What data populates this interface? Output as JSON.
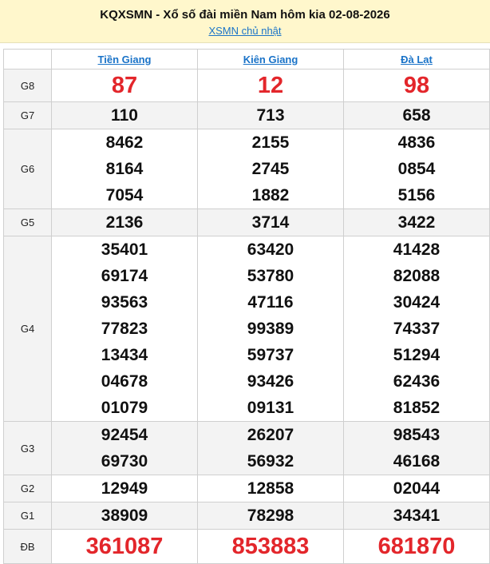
{
  "header": {
    "title": "KQXSMN - Xổ số đài miền Nam hôm kia 02-08-2026",
    "link": "XSMN chủ nhật"
  },
  "colors": {
    "accent_red": "#e3262b",
    "link_blue": "#1a73c8",
    "header_bg": "#fff7cc"
  },
  "provinces": [
    "Tiền Giang",
    "Kiên Giang",
    "Đà Lạt"
  ],
  "prizes": [
    {
      "label": "G8",
      "style": "big",
      "alt": false,
      "values": [
        [
          "87"
        ],
        [
          "12"
        ],
        [
          "98"
        ]
      ]
    },
    {
      "label": "G7",
      "style": "normal",
      "alt": true,
      "values": [
        [
          "110"
        ],
        [
          "713"
        ],
        [
          "658"
        ]
      ]
    },
    {
      "label": "G6",
      "style": "normal",
      "alt": false,
      "values": [
        [
          "8462",
          "8164",
          "7054"
        ],
        [
          "2155",
          "2745",
          "1882"
        ],
        [
          "4836",
          "0854",
          "5156"
        ]
      ]
    },
    {
      "label": "G5",
      "style": "normal",
      "alt": true,
      "values": [
        [
          "2136"
        ],
        [
          "3714"
        ],
        [
          "3422"
        ]
      ]
    },
    {
      "label": "G4",
      "style": "normal",
      "alt": false,
      "values": [
        [
          "35401",
          "69174",
          "93563",
          "77823",
          "13434",
          "04678",
          "01079"
        ],
        [
          "63420",
          "53780",
          "47116",
          "99389",
          "59737",
          "93426",
          "09131"
        ],
        [
          "41428",
          "82088",
          "30424",
          "74337",
          "51294",
          "62436",
          "81852"
        ]
      ]
    },
    {
      "label": "G3",
      "style": "normal",
      "alt": true,
      "values": [
        [
          "92454",
          "69730"
        ],
        [
          "26207",
          "56932"
        ],
        [
          "98543",
          "46168"
        ]
      ]
    },
    {
      "label": "G2",
      "style": "normal",
      "alt": false,
      "values": [
        [
          "12949"
        ],
        [
          "12858"
        ],
        [
          "02044"
        ]
      ]
    },
    {
      "label": "G1",
      "style": "normal",
      "alt": true,
      "values": [
        [
          "38909"
        ],
        [
          "78298"
        ],
        [
          "34341"
        ]
      ]
    },
    {
      "label": "ĐB",
      "style": "special",
      "alt": false,
      "values": [
        [
          "361087"
        ],
        [
          "853883"
        ],
        [
          "681870"
        ]
      ]
    }
  ]
}
